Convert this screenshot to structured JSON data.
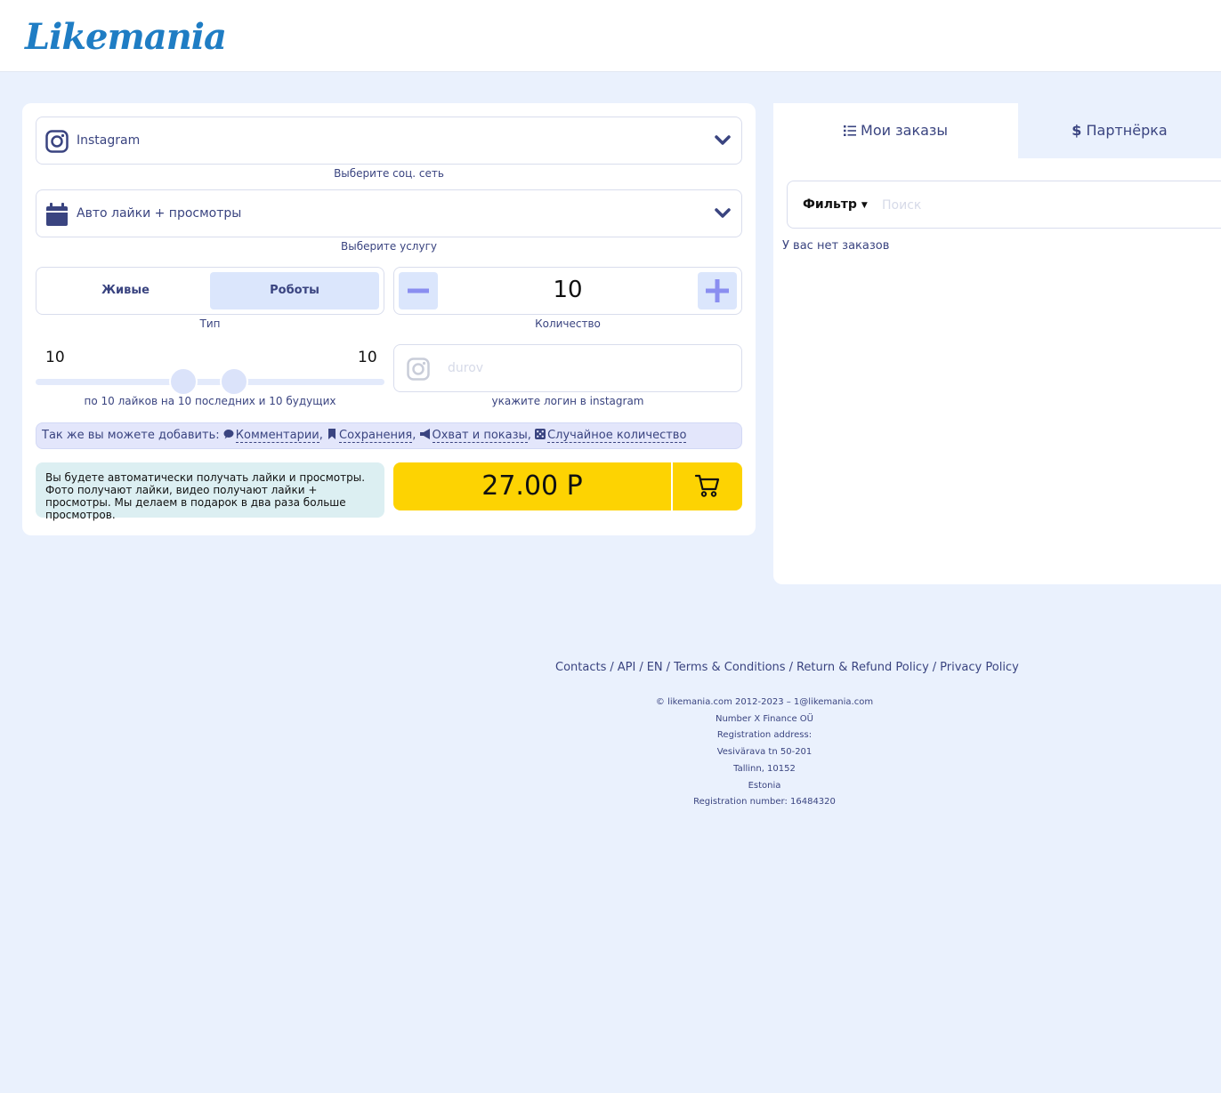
{
  "header": {
    "logo_text": "Likemania"
  },
  "form": {
    "network": {
      "value": "Instagram",
      "hint": "Выберите соц. сеть"
    },
    "service": {
      "value": "Авто лайки + просмотры",
      "hint": "Выберите услугу"
    },
    "type": {
      "options": [
        "Живые",
        "Роботы"
      ],
      "selected": "Роботы",
      "hint": "Тип"
    },
    "quantity": {
      "value": "10",
      "hint": "Количество"
    },
    "range": {
      "min_label": "10",
      "max_label": "10",
      "hint": "по 10 лайков на 10 последних и 10 будущих"
    },
    "login": {
      "placeholder": "durov",
      "hint": "укажите логин в instagram"
    },
    "addons": {
      "prefix": "Так же вы можете добавить:",
      "items": [
        "Комментарии",
        "Сохранения",
        "Охват и показы",
        "Случайное количество"
      ]
    },
    "info_text": "Вы будете автоматически получать лайки и просмотры. Фото получают лайки, видео получают лайки + просмотры. Мы делаем в подарок в два раза больше просмотров.",
    "price": "27.00 Р"
  },
  "sidebar": {
    "tabs": [
      "Мои заказы",
      "Партнёрка"
    ],
    "filter_label": "Фильтр",
    "search_placeholder": "Поиск",
    "empty_text": "У вас нет заказов"
  },
  "footer": {
    "links": [
      "Contacts",
      "API",
      "EN",
      "Terms & Conditions",
      "Return & Refund Policy",
      "Privacy Policy"
    ],
    "lines": [
      "© likemania.com 2012-2023 – 1@likemania.com",
      "Number X Finance OÜ",
      "Registration address:",
      "Vesivärava tn 50-201",
      "Tallinn, 10152",
      "Estonia",
      "Registration number: 16484320"
    ]
  },
  "colors": {
    "accent": "#3a4480",
    "logo": "#1f7dc4",
    "price_bg": "#fdd302",
    "page_bg": "#eaf1fd",
    "plus_minus": "#8a8ef0"
  }
}
